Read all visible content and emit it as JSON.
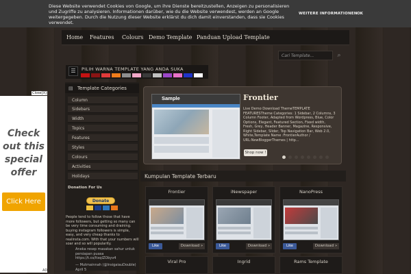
{
  "cookie": {
    "text": "Diese Website verwendet Cookies von Google, um ihre Dienste bereitzustellen, Anzeigen zu personalisieren und Zugriffe zu analysieren. Informationen darüber, wie du die Website verwendest, werden an Google weitergegeben. Durch die Nutzung dieser Website erklärst du dich damit einverstanden, dass sie Cookies verwendet.",
    "more_label": "WEITERE INFORMATIONEN",
    "ok_label": "OK"
  },
  "nav": {
    "items": [
      "Home",
      "Features",
      "Colours",
      "Demo Template",
      "Panduan Upload Template"
    ]
  },
  "search": {
    "placeholder": "Cari Template..."
  },
  "color_chooser": {
    "title": "PILIH WARNA TEMPLATE YANG ANDA SUKA",
    "swatches": [
      "#c41212",
      "#8a1414",
      "#e03a3a",
      "#f07c1b",
      "#8f8f8f",
      "#f5a9c9",
      "#3a3a3a",
      "#c0c0c0",
      "#9b47c8",
      "#e872c8",
      "#1f33c7",
      "#ffffff"
    ]
  },
  "categories": {
    "title": "Template Categories",
    "items": [
      "Column",
      "Sidebars",
      "Width",
      "Topics",
      "Features",
      "Styles",
      "Colours",
      "Activities",
      "Holidays"
    ]
  },
  "donation": {
    "title": "Donation For Us",
    "button_label": "Donate",
    "text": "People tend to follow those that have more followers, but getting so many can be very time consuming and draining. buying instagram followers is simple, easy, and very cheap thanks to realinsta.com. With that your numbers will soar and so will popularity.",
    "quote1": "Aneka resep masakan sahur untuk persiapan puasa https://t.co/ltxqlZObyv4",
    "quote2": "— Mutmainnah (@InsigaiauDouble) April 5"
  },
  "featured": {
    "title": "Frontier",
    "description": "Live Demo Download ThemeTEMPLATE FEATURESTheme Categories: 1 Sidebar, 2 Columns, 3 Column Footer, Adapted from Wordpress, Blue, Color Options, Elegant, Featured Section, Fixed width, Fresh, Grey, Header Banner, Magazine, Responsive, Right Sidebar, Slider, Top Navigation Bar, Web 2.0, White,Template Name :FrontierAuthor / URL:NewBloggerThemes | http...",
    "button_label": "Shop now !",
    "preview_logo": "Sample"
  },
  "latest": {
    "title": "Kumpulan Template Terbaru",
    "templates": [
      {
        "name": "Frontier",
        "like": "Like",
        "download": "Download »"
      },
      {
        "name": "iNewspaper",
        "like": "Like",
        "download": "Download »"
      },
      {
        "name": "NanoPress",
        "like": "Like",
        "download": "Download »"
      }
    ],
    "templates_row2": [
      {
        "name": "Viral Pro"
      },
      {
        "name": "Ingrid"
      },
      {
        "name": "Rams Template"
      }
    ]
  },
  "ad": {
    "close_label": "Close[X]",
    "text": "Check out this special offer",
    "cta_label": "Click Here",
    "ad_label": "AD"
  }
}
